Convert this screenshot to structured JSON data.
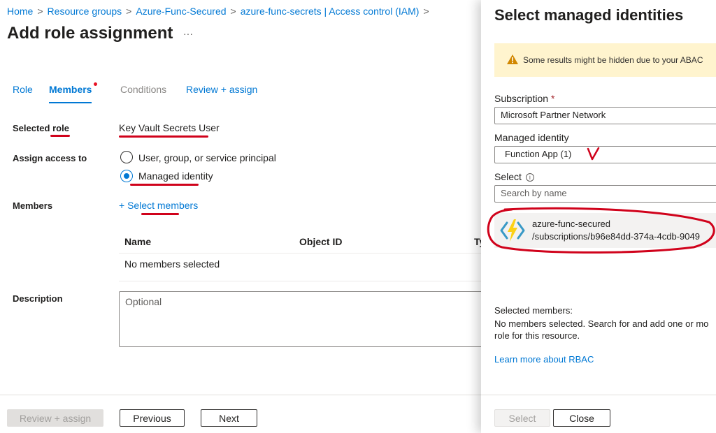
{
  "breadcrumb": {
    "items": [
      "Home",
      "Resource groups",
      "Azure-Func-Secured",
      "azure-func-secrets | Access control (IAM)"
    ],
    "separator": ">"
  },
  "page": {
    "title": "Add role assignment",
    "more": "···"
  },
  "tabs": [
    "Role",
    "Members",
    "Conditions",
    "Review + assign"
  ],
  "form": {
    "selected_role_label_prefix": "Selected",
    "selected_role_label_suffix": "role",
    "selected_role_value": "Key Vault Secrets User",
    "assign_access_label": "Assign access to",
    "assign_options": [
      "User, group, or service principal",
      "Managed identity"
    ],
    "members_label": "Members",
    "select_members_plus": "+",
    "select_members_link": "Select members",
    "table_headers": [
      "Name",
      "Object ID",
      "Ty"
    ],
    "empty_members": "No members selected",
    "description_label": "Description",
    "description_placeholder": "Optional"
  },
  "footer": {
    "review_assign": "Review + assign",
    "previous": "Previous",
    "next": "Next"
  },
  "panel": {
    "title": "Select managed identities",
    "warning": "Some results might be hidden due to your ABAC",
    "subscription_label": "Subscription",
    "required_mark": "*",
    "subscription_value": "Microsoft Partner Network",
    "managed_identity_label": "Managed identity",
    "managed_identity_value": "Function App (1)",
    "select_label": "Select",
    "search_placeholder": "Search by name",
    "result_name": "azure-func-secured",
    "result_path": "/subscriptions/b96e84dd-374a-4cdb-9049",
    "selected_members_label": "Selected members:",
    "selected_members_text_line1": "No members selected. Search for and add one or mo",
    "selected_members_text_line2": "role for this resource.",
    "learn_more": "Learn more about RBAC",
    "select_button": "Select",
    "close_button": "Close"
  },
  "colors": {
    "accent": "#0078d4",
    "annotation_ink": "#d0021b",
    "warning_bg": "#fff4ce",
    "warning_icon": "#d18700"
  }
}
